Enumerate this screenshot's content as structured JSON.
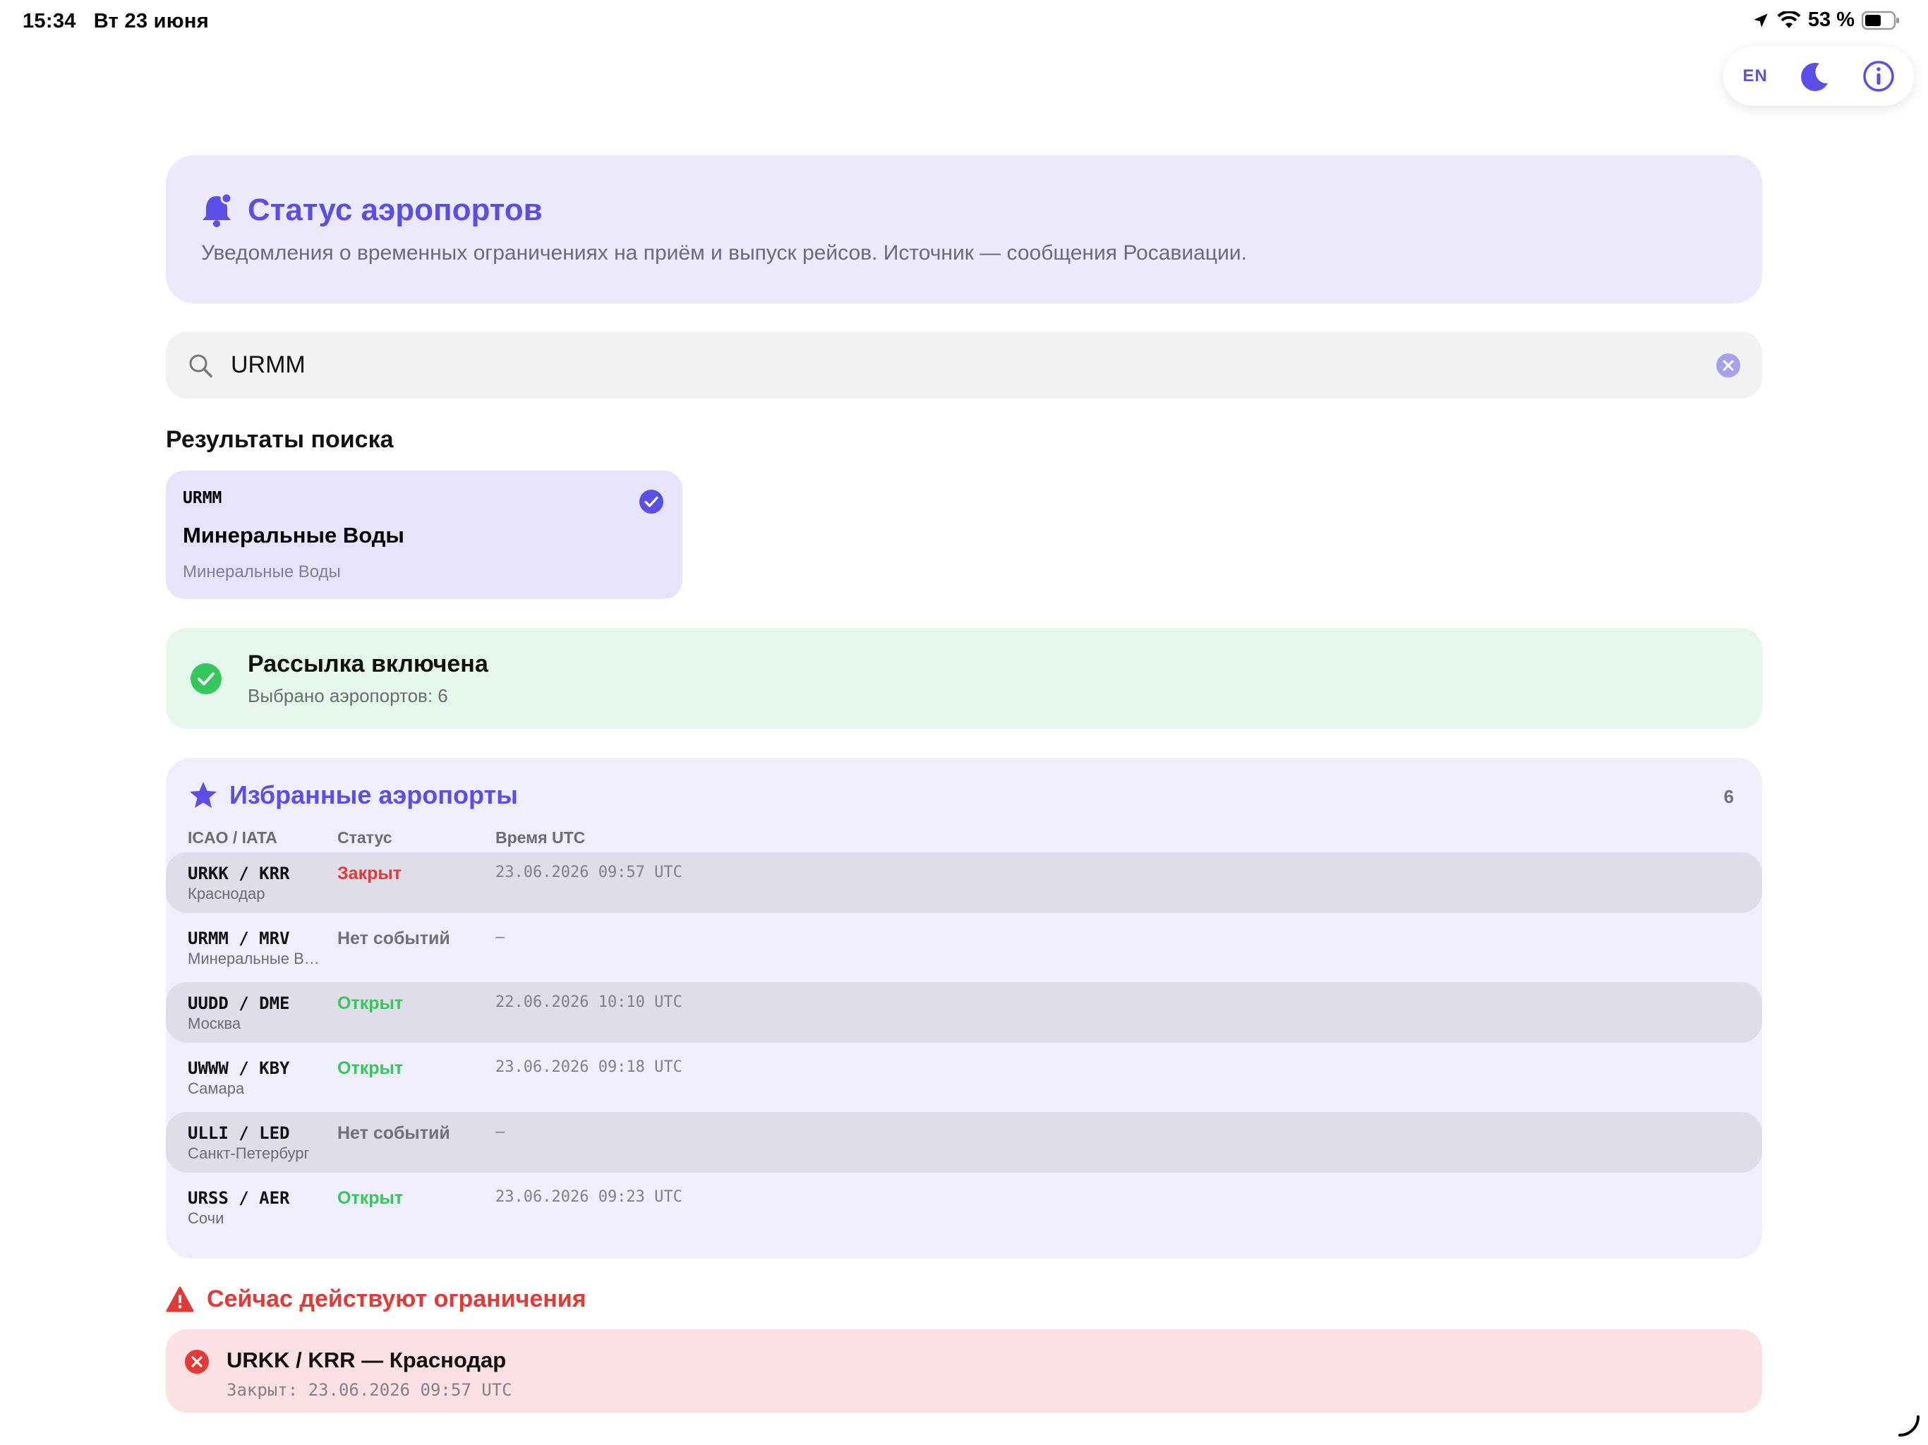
{
  "status_bar": {
    "time": "15:34",
    "date": "Вт 23 июня",
    "battery": "53 %"
  },
  "toolbar": {
    "lang": "EN"
  },
  "header": {
    "title": "Статус аэропортов",
    "subtitle": "Уведомления о временных ограничениях на приём и выпуск рейсов. Источник — сообщения Росавиации."
  },
  "search": {
    "value": "URMM"
  },
  "results": {
    "title": "Результаты поиска",
    "item": {
      "code": "URMM",
      "name": "Минеральные Воды",
      "city": "Минеральные Воды",
      "selected": true
    }
  },
  "subscription": {
    "title": "Рассылка включена",
    "subtitle": "Выбрано аэропортов: 6"
  },
  "favorites": {
    "title": "Избранные аэропорты",
    "count": "6",
    "columns": {
      "code": "ICAO / IATA",
      "status": "Статус",
      "time": "Время UTC"
    },
    "rows": [
      {
        "code": "URKK / KRR",
        "city": "Краснодар",
        "status": "Закрыт",
        "time": "23.06.2026 09:57 UTC"
      },
      {
        "code": "URMM / MRV",
        "city": "Минеральные Воды",
        "status": "Нет событий",
        "time": "—"
      },
      {
        "code": "UUDD / DME",
        "city": "Москва",
        "status": "Открыт",
        "time": "22.06.2026 10:10 UTC"
      },
      {
        "code": "UWWW / KBY",
        "city": "Самара",
        "status": "Открыт",
        "time": "23.06.2026 09:18 UTC"
      },
      {
        "code": "ULLI / LED",
        "city": "Санкт-Петербург",
        "status": "Нет событий",
        "time": "—"
      },
      {
        "code": "URSS / AER",
        "city": "Сочи",
        "status": "Открыт",
        "time": "23.06.2026 09:23 UTC"
      }
    ]
  },
  "restrictions": {
    "title": "Сейчас действуют ограничения",
    "item": {
      "title": "URKK / KRR — Краснодар",
      "detail": "Закрыт: 23.06.2026 09:57 UTC"
    }
  },
  "colors": {
    "accent": "#5b4ee6",
    "closed": "#e53935",
    "open": "#34c759",
    "none": "#70707a"
  }
}
